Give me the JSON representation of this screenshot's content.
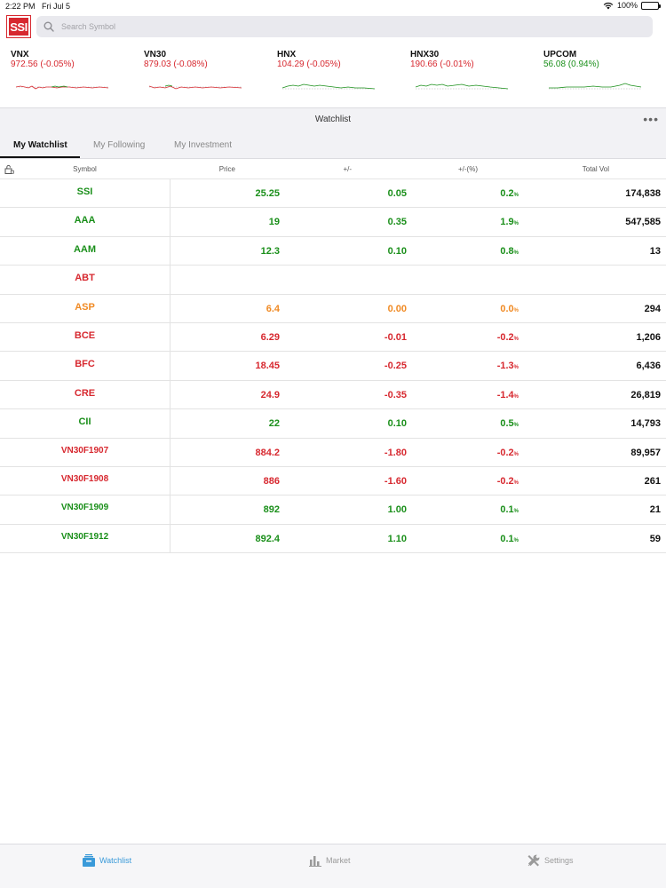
{
  "status": {
    "time": "2:22 PM",
    "date": "Fri Jul 5",
    "battery": "100%"
  },
  "app": {
    "logo": "SSI"
  },
  "search": {
    "placeholder": "Search Symbol"
  },
  "indices": [
    {
      "name": "VNX",
      "value": "972.56 (-0.05%)",
      "trend": "neg"
    },
    {
      "name": "VN30",
      "value": "879.03 (-0.08%)",
      "trend": "neg"
    },
    {
      "name": "HNX",
      "value": "104.29 (-0.05%)",
      "trend": "neg"
    },
    {
      "name": "HNX30",
      "value": "190.66 (-0.01%)",
      "trend": "neg"
    },
    {
      "name": "UPCOM",
      "value": "56.08 (0.94%)",
      "trend": "pos"
    }
  ],
  "watchlist": {
    "title": "Watchlist",
    "more": "•••",
    "tabs": [
      "My Watchlist",
      "My Following",
      "My Investment"
    ]
  },
  "table": {
    "headers": {
      "symbol": "Symbol",
      "price": "Price",
      "change": "+/-",
      "pct": "+/-(%)",
      "vol": "Total Vol"
    },
    "pct_unit": "%",
    "rows": [
      {
        "symbol": "SSI",
        "price": "25.25",
        "change": "0.05",
        "pct": "0.2",
        "vol": "174,838",
        "color": "green"
      },
      {
        "symbol": "AAA",
        "price": "19",
        "change": "0.35",
        "pct": "1.9",
        "vol": "547,585",
        "color": "green"
      },
      {
        "symbol": "AAM",
        "price": "12.3",
        "change": "0.10",
        "pct": "0.8",
        "vol": "13",
        "color": "green"
      },
      {
        "symbol": "ABT",
        "price": "",
        "change": "",
        "pct": "",
        "vol": "",
        "color": "red"
      },
      {
        "symbol": "ASP",
        "price": "6.4",
        "change": "0.00",
        "pct": "0.0",
        "vol": "294",
        "color": "orange"
      },
      {
        "symbol": "BCE",
        "price": "6.29",
        "change": "-0.01",
        "pct": "-0.2",
        "vol": "1,206",
        "color": "red"
      },
      {
        "symbol": "BFC",
        "price": "18.45",
        "change": "-0.25",
        "pct": "-1.3",
        "vol": "6,436",
        "color": "red"
      },
      {
        "symbol": "CRE",
        "price": "24.9",
        "change": "-0.35",
        "pct": "-1.4",
        "vol": "26,819",
        "color": "red"
      },
      {
        "symbol": "CII",
        "price": "22",
        "change": "0.10",
        "pct": "0.5",
        "vol": "14,793",
        "color": "green"
      },
      {
        "symbol": "VN30F1907",
        "price": "884.2",
        "change": "-1.80",
        "pct": "-0.2",
        "vol": "89,957",
        "color": "red"
      },
      {
        "symbol": "VN30F1908",
        "price": "886",
        "change": "-1.60",
        "pct": "-0.2",
        "vol": "261",
        "color": "red"
      },
      {
        "symbol": "VN30F1909",
        "price": "892",
        "change": "1.00",
        "pct": "0.1",
        "vol": "21",
        "color": "green"
      },
      {
        "symbol": "VN30F1912",
        "price": "892.4",
        "change": "1.10",
        "pct": "0.1",
        "vol": "59",
        "color": "green"
      }
    ]
  },
  "bottom_tabs": [
    {
      "label": "Watchlist",
      "icon": "watchlist-tray-icon",
      "active": true
    },
    {
      "label": "Market",
      "icon": "bar-chart-icon",
      "active": false
    },
    {
      "label": "Settings",
      "icon": "wrench-screwdriver-icon",
      "active": false
    }
  ],
  "colors": {
    "green": "#1a8f1a",
    "red": "#d7282f",
    "orange": "#f08a24",
    "accent": "#3a9ad9"
  }
}
